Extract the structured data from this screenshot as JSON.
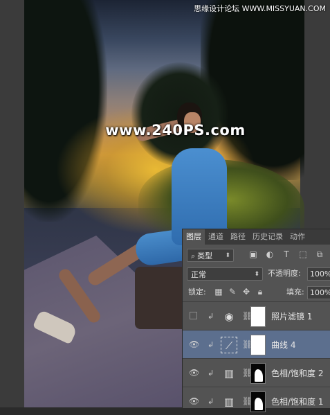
{
  "watermark": {
    "center_text": "www.240PS.com",
    "site_text": "思缘设计论坛 WWW.MISSYUAN.COM"
  },
  "layers_panel": {
    "tabs": [
      {
        "label": "图层",
        "active": true
      },
      {
        "label": "通道",
        "active": false
      },
      {
        "label": "路径",
        "active": false
      },
      {
        "label": "历史记录",
        "active": false
      },
      {
        "label": "动作",
        "active": false
      }
    ],
    "filter_kind": "类型",
    "blend_mode": "正常",
    "opacity_label": "不透明度:",
    "opacity_value": "100%",
    "lock_label": "锁定:",
    "fill_label": "填充:",
    "fill_value": "100%",
    "layers": [
      {
        "name": "照片滤镜 1",
        "visible": false,
        "selected": false,
        "adjust_icon": "photo-filter-icon",
        "mask": "white"
      },
      {
        "name": "曲线 4",
        "visible": true,
        "selected": true,
        "adjust_icon": "curves-icon",
        "mask": "white"
      },
      {
        "name": "色相/饱和度 2",
        "visible": true,
        "selected": false,
        "adjust_icon": "hue-saturation-icon",
        "mask": "dark"
      },
      {
        "name": "色相/饱和度 1",
        "visible": true,
        "selected": false,
        "adjust_icon": "hue-saturation-icon",
        "mask": "dark"
      }
    ]
  }
}
